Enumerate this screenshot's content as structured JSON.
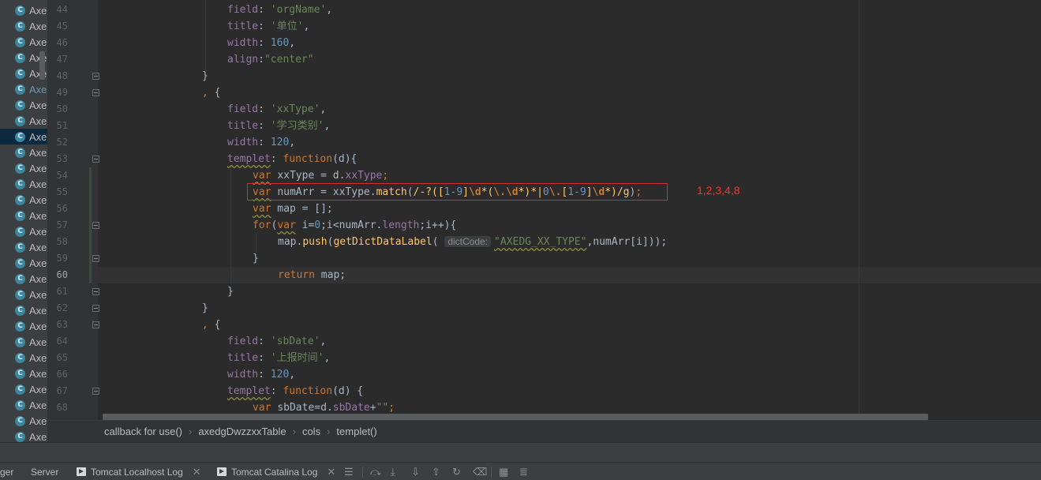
{
  "project_tree": {
    "item_label": "Axe",
    "icon": "class-c-icon",
    "item_count": 28,
    "selected_index": 8,
    "highlighted_index": 5
  },
  "editor": {
    "line_numbers": [
      "44",
      "45",
      "46",
      "47",
      "48",
      "49",
      "50",
      "51",
      "52",
      "53",
      "54",
      "55",
      "56",
      "57",
      "58",
      "59",
      "60",
      "61",
      "62",
      "63",
      "64",
      "65",
      "66",
      "67",
      "68"
    ],
    "current_line": "60",
    "param_hint": "dictCode:",
    "annotation": "1,2,3,4,8",
    "code": {
      "l44": {
        "key": "field",
        "val": "'orgName'"
      },
      "l45": {
        "key": "title",
        "val": "'单位'"
      },
      "l46": {
        "key": "width",
        "val": "160"
      },
      "l47": {
        "key": "align",
        "val": "\"center\""
      },
      "l50": {
        "key": "field",
        "val": "'xxType'"
      },
      "l51": {
        "key": "title",
        "val": "'学习类别'"
      },
      "l52": {
        "key": "width",
        "val": "120"
      },
      "l53": {
        "key": "templet",
        "fn": "function",
        "param": "(d){"
      },
      "l54": {
        "var": "var",
        "name": "xxType",
        "rhs_obj": "d",
        "rhs_prop": "xxType"
      },
      "l55": {
        "var": "var",
        "name": "numArr",
        "obj": "xxType",
        "method": "match"
      },
      "l56": {
        "var": "var",
        "name": "map",
        "rhs": "[];"
      },
      "l57": {
        "for": "for",
        "var": "var",
        "init": "i=",
        "zero": "0",
        "cond": ";i<numArr.",
        "len": "length",
        "inc": ";i++){"
      },
      "l58": {
        "obj": "map",
        "method": "push",
        "call": "getDictDataLabel",
        "str": "\"AXEDG_XX_TYPE\"",
        "arg": ",numArr[i]));"
      },
      "l60": {
        "ret": "return",
        "val": "map;"
      },
      "l64": {
        "key": "field",
        "val": "'sbDate'"
      },
      "l65": {
        "key": "title",
        "val": "'上报时间'"
      },
      "l66": {
        "key": "width",
        "val": "120"
      },
      "l67": {
        "key": "templet",
        "fn": "function",
        "param": "(d) {"
      },
      "l68": {
        "var": "var",
        "name": "sbDate",
        "obj": "d",
        "prop": "sbDate",
        "str": "\"\""
      }
    }
  },
  "breadcrumb": [
    "callback for use()",
    "axedgDwzzxxTable",
    "cols",
    "templet()"
  ],
  "bottom_bar": {
    "tabs": [
      "ger",
      "Server",
      "Tomcat Localhost Log",
      "Tomcat Catalina Log"
    ],
    "tools": [
      "menu-lines-icon",
      "soft-wrap-icon",
      "scroll-end-icon",
      "download-icon",
      "upload-icon",
      "restore-icon",
      "clear-icon",
      "table-icon",
      "settings-list-icon"
    ]
  }
}
